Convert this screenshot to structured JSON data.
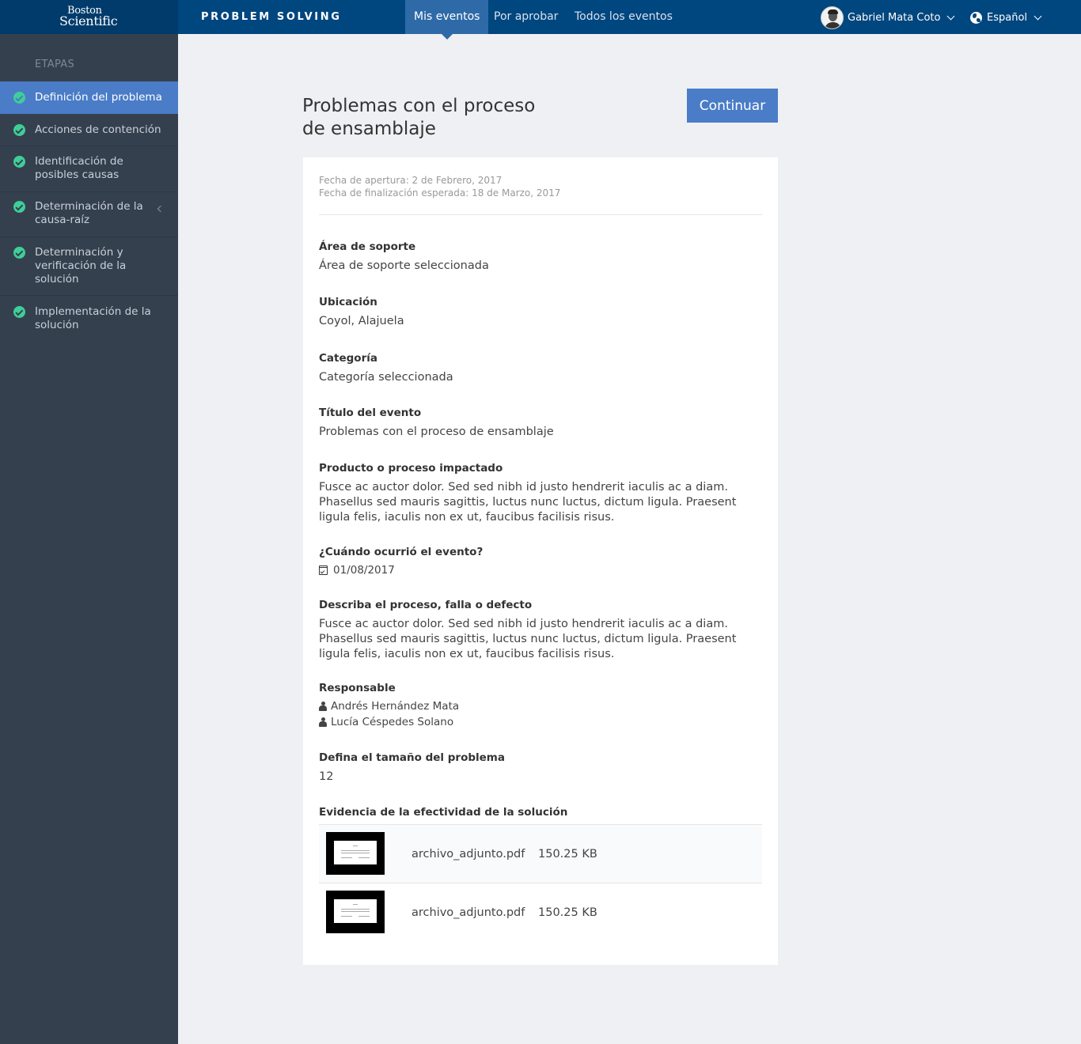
{
  "header": {
    "logo_line1": "Boston",
    "logo_line2": "Scientific",
    "app_title": "PROBLEM SOLVING",
    "tabs": [
      {
        "label": "Mis eventos",
        "active": true
      },
      {
        "label": "Por aprobar",
        "active": false
      },
      {
        "label": "Todos los eventos",
        "active": false
      }
    ],
    "user_name": "Gabriel Mata Coto",
    "language": "Español"
  },
  "sidebar": {
    "heading": "ETAPAS",
    "stages": [
      {
        "label": "Definición del problema",
        "completed": true,
        "active": true
      },
      {
        "label": "Acciones de contención",
        "completed": true,
        "active": false
      },
      {
        "label": "Identificación de posibles causas",
        "completed": true,
        "active": false
      },
      {
        "label": "Determinación de la causa-raíz",
        "completed": true,
        "active": false
      },
      {
        "label": "Determinación y verificación de la solución",
        "completed": true,
        "active": false
      },
      {
        "label": "Implementación de la solución",
        "completed": true,
        "active": false
      }
    ]
  },
  "main": {
    "title": "Problemas con el proceso de ensamblaje",
    "continue_label": "Continuar",
    "opening_date": "Fecha de apertura: 2 de Febrero, 2017",
    "expected_end_date": "Fecha de finalización esperada: 18 de Marzo, 2017",
    "fields": {
      "support_area_label": "Área de soporte",
      "support_area_value": "Área de soporte seleccionada",
      "location_label": "Ubicación",
      "location_value": "Coyol, Alajuela",
      "category_label": "Categoría",
      "category_value": "Categoría seleccionada",
      "event_title_label": "Título del evento",
      "event_title_value": "Problemas con el proceso de ensamblaje",
      "product_label": "Producto o proceso impactado",
      "product_value": "Fusce ac auctor dolor. Sed sed nibh id justo hendrerit iaculis ac a diam. Phasellus sed mauris sagittis, luctus nunc luctus, dictum ligula. Praesent ligula felis, iaculis non ex ut, faucibus facilisis risus.",
      "when_label": "¿Cuándo ocurrió el evento?",
      "when_value": "01/08/2017",
      "describe_label": "Describa el proceso, falla o defecto",
      "describe_value": "Fusce ac auctor dolor. Sed sed nibh id justo hendrerit iaculis ac a diam. Phasellus sed mauris sagittis, luctus nunc luctus, dictum ligula. Praesent ligula felis, iaculis non ex ut, faucibus facilisis risus.",
      "responsible_label": "Responsable",
      "responsibles": [
        "Andrés Hernández Mata",
        "Lucía Céspedes Solano"
      ],
      "size_label": "Defina el tamaño del problema",
      "size_value": "12"
    },
    "evidence_title": "Evidencia de la efectividad de la solución",
    "files": [
      {
        "name": "archivo_adjunto.pdf",
        "size": "150.25 KB"
      },
      {
        "name": "archivo_adjunto.pdf",
        "size": "150.25 KB"
      }
    ]
  }
}
